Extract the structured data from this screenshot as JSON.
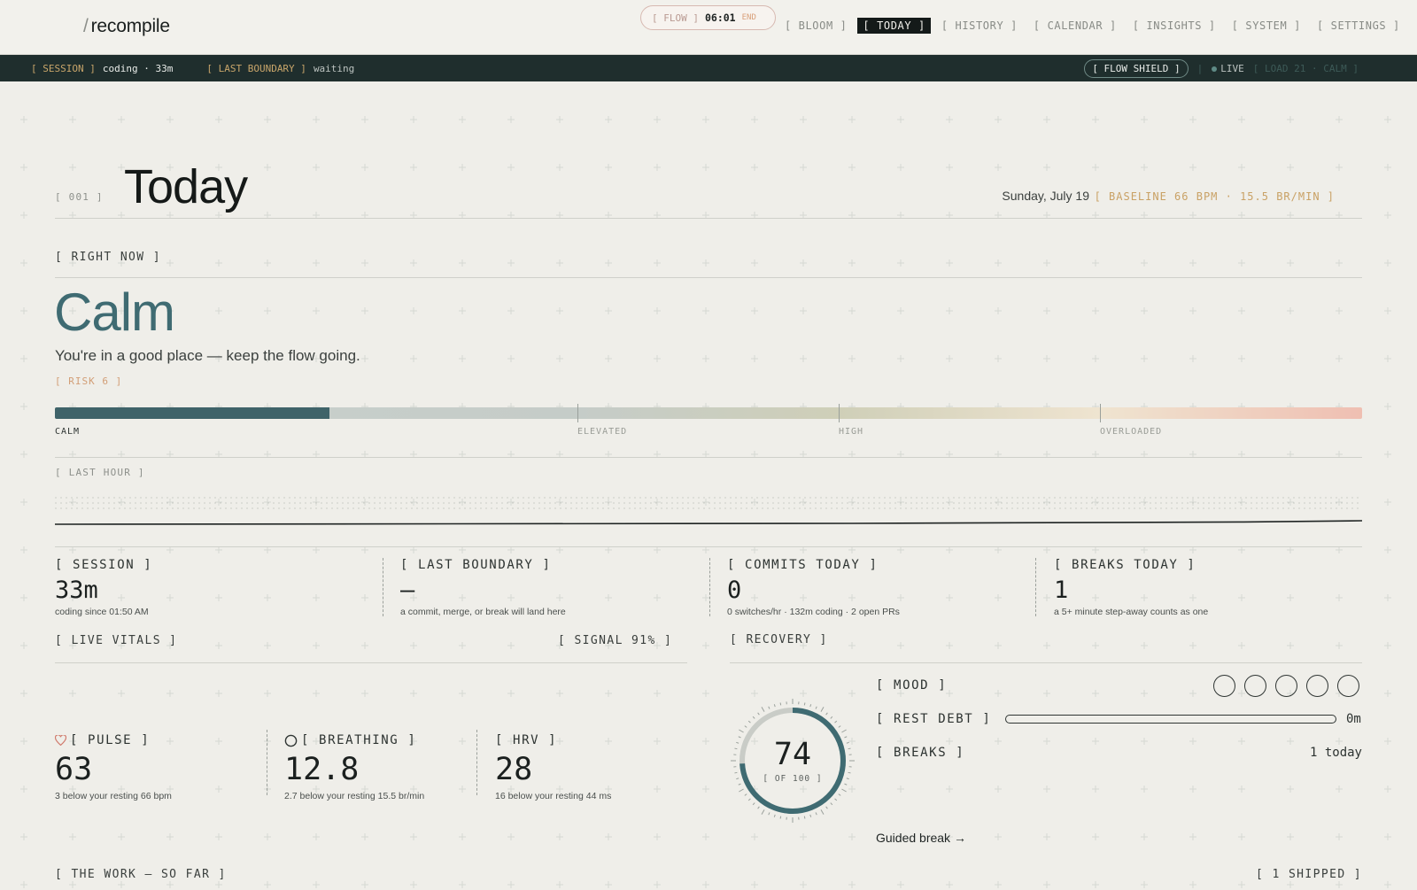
{
  "app": {
    "logo_slash": "/",
    "name": "recompile"
  },
  "flow": {
    "label": "[ FLOW ]",
    "time": "06:01",
    "end": "END"
  },
  "nav": {
    "items": [
      "[ BLOOM ]",
      "[ TODAY ]",
      "[ HISTORY ]",
      "[ CALENDAR ]",
      "[ INSIGHTS ]",
      "[ SYSTEM ]",
      "[ SETTINGS ]"
    ],
    "active": "[ TODAY ]"
  },
  "status": {
    "session_tag": "[ SESSION ]",
    "session_value": "coding · 33m",
    "boundary_tag": "[ LAST BOUNDARY ]",
    "boundary_value": "waiting",
    "flow_shield": "[ FLOW SHIELD ]",
    "live": "LIVE",
    "load": "[ LOAD 21 · CALM ]"
  },
  "page": {
    "index": "[ 001 ]",
    "title": "Today",
    "date": "Sunday, July 19",
    "baseline": "[ BASELINE 66 BPM · 15.5 BR/MIN ]"
  },
  "right_now": {
    "tag": "[ RIGHT NOW ]",
    "state": "Calm",
    "message": "You're in a good place — keep the flow going.",
    "risk": "[ RISK 6 ]",
    "risk_value": 6,
    "scale_labels": [
      "CALM",
      "ELEVATED",
      "HIGH",
      "OVERLOADED"
    ]
  },
  "last_hour": {
    "tag": "[ LAST HOUR ]"
  },
  "stats": [
    {
      "label": "[ SESSION ]",
      "value": "33m",
      "note": "coding since 01:50 AM"
    },
    {
      "label": "[ LAST BOUNDARY ]",
      "value": "—",
      "note": "a commit, merge, or break will land here"
    },
    {
      "label": "[ COMMITS TODAY ]",
      "value": "0",
      "note": "0 switches/hr · 132m coding · 2 open PRs"
    },
    {
      "label": "[ BREAKS TODAY ]",
      "value": "1",
      "note": "a 5+ minute step-away counts as one"
    }
  ],
  "vitals": {
    "tag": "[ LIVE VITALS ]",
    "signal": "[ SIGNAL 91% ]",
    "pulse": {
      "label": "[ PULSE ]",
      "value": "63",
      "note": "3 below your resting 66 bpm",
      "icon": "heart-icon"
    },
    "breathing": {
      "label": "[ BREATHING ]",
      "value": "12.8",
      "note": "2.7 below your resting 15.5 br/min",
      "icon": "circle-icon"
    },
    "hrv": {
      "label": "[ HRV ]",
      "value": "28",
      "note": "16 below your resting 44 ms"
    }
  },
  "recovery": {
    "tag": "[ RECOVERY ]",
    "score": "74",
    "score_value": 74,
    "of": "[ OF 100 ]",
    "mood_label": "[ MOOD ]",
    "rest_debt_label": "[ REST DEBT ]",
    "rest_debt_value": "0m",
    "breaks_label": "[ BREAKS ]",
    "breaks_value": "1 today",
    "guided": "Guided break →"
  },
  "work": {
    "tag": "[ THE WORK — SO FAR ]",
    "shipped": "[ 1 SHIPPED ]"
  },
  "colors": {
    "accent": "#3f6b72",
    "strip": "#1f2e2d",
    "risk": "#d29e76",
    "baseline": "#c9a165"
  }
}
